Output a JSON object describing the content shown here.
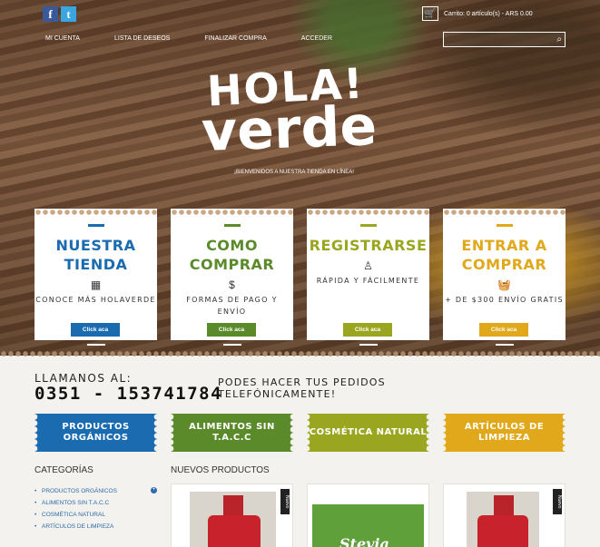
{
  "header": {
    "social": [
      {
        "name": "facebook-icon",
        "glyph": "f"
      },
      {
        "name": "twitter-icon",
        "glyph": "t"
      }
    ],
    "cart_text": "Carrito: 0 artículo(s) - ARS 0.00",
    "nav": [
      "MI CUENTA",
      "LISTA DE DESEOS",
      "FINALIZAR COMPRA",
      "ACCEDER"
    ],
    "search_placeholder": ""
  },
  "hero": {
    "logo_line1": "HOLA!",
    "logo_line2": "verde",
    "welcome": "¡BIENVENIDOS A NUESTRA TIENDA EN LÍNEA!"
  },
  "cards": [
    {
      "title": "NUESTRA TIENDA",
      "icon": "store-icon",
      "glyph": "▦",
      "desc": "CONOCE MÁS HOLAVERDE",
      "button": "Click aca",
      "color": "#1a6bb0"
    },
    {
      "title": "COMO COMPRAR",
      "icon": "dollar-icon",
      "glyph": "$",
      "desc": "FORMAS DE PAGO Y ENVÍO",
      "button": "Click aca",
      "color": "#5a8a2a"
    },
    {
      "title": "REGISTRARSE",
      "icon": "user-icon",
      "glyph": "♙",
      "desc": "RÁPIDA Y FÁCILMENTE",
      "button": "Click aca",
      "color": "#9aa620"
    },
    {
      "title": "ENTRAR A COMPRAR",
      "icon": "basket-icon",
      "glyph": "🧺",
      "desc": "+ DE $300 ENVÍO GRATIS",
      "button": "Click aca",
      "color": "#e0a81a"
    }
  ],
  "phone": {
    "label": "LLAMANOS AL:",
    "number": "0351 - 153741784",
    "note": "PODES HACER TUS PEDIDOS TELEFÓNICAMENTE!"
  },
  "categories_banners": [
    {
      "label": "PRODUCTOS ORGÁNICOS",
      "color": "#1a6bb0"
    },
    {
      "label": "ALIMENTOS SIN T.A.C.C",
      "color": "#5a8a2a"
    },
    {
      "label": "COSMÉTICA NATURAL",
      "color": "#9aa620"
    },
    {
      "label": "ARTÍCULOS DE LIMPIEZA",
      "color": "#e0a81a"
    }
  ],
  "sidebar": {
    "title": "CATEGORÍAS",
    "items": [
      "PRODUCTOS ORGÁNICOS",
      "ALIMENTOS SIN T.A.C.C",
      "COSMÉTICA NATURAL",
      "ARTÍCULOS DE LIMPIEZA"
    ]
  },
  "new_products": {
    "title": "NUEVOS PRODUCTOS",
    "badge": "Nuevo",
    "stevia_label": "Stevia"
  }
}
